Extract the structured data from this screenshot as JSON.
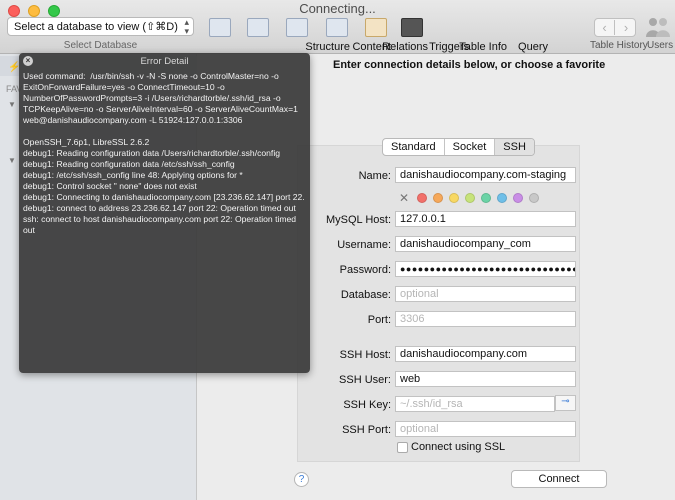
{
  "window": {
    "title": "Connecting..."
  },
  "toolbar": {
    "db_select": {
      "value": "Select a database to view (⇧⌘D)",
      "caption": "Select Database"
    },
    "items": [
      {
        "label": "Structure",
        "icon": "structure-icon"
      },
      {
        "label": "Content",
        "icon": "content-icon"
      },
      {
        "label": "Relations",
        "icon": "relations-icon"
      },
      {
        "label": "Triggers",
        "icon": "triggers-icon"
      },
      {
        "label": "Table Info",
        "icon": "table-info-icon"
      },
      {
        "label": "Query",
        "icon": "query-icon"
      }
    ],
    "table_history": "Table History",
    "users": "Users"
  },
  "sidebar": {
    "section": "FAV"
  },
  "main": {
    "heading": "Enter connection details below, or choose a favorite",
    "tabs": [
      {
        "label": "Standard"
      },
      {
        "label": "Socket"
      },
      {
        "label": "SSH"
      }
    ],
    "colors": [
      "#f2706a",
      "#f6a85a",
      "#f8d863",
      "#c7e37a",
      "#6bd3a6",
      "#6fbfe8",
      "#c98ee6",
      "#c8c8c8"
    ],
    "fields": {
      "name": {
        "label": "Name:",
        "value": "danishaudiocompany.com-staging"
      },
      "mysql_host": {
        "label": "MySQL Host:",
        "value": "127.0.0.1"
      },
      "username": {
        "label": "Username:",
        "value": "danishaudiocompany_com"
      },
      "password": {
        "label": "Password:",
        "value": "●●●●●●●●●●●●●●●●●●●●●●●●●●●●●●●●●●●"
      },
      "database": {
        "label": "Database:",
        "placeholder": "optional"
      },
      "port": {
        "label": "Port:",
        "placeholder": "3306"
      },
      "ssh_host": {
        "label": "SSH Host:",
        "value": "danishaudiocompany.com"
      },
      "ssh_user": {
        "label": "SSH User:",
        "value": "web"
      },
      "ssh_key": {
        "label": "SSH Key:",
        "placeholder": "~/.ssh/id_rsa"
      },
      "ssh_port": {
        "label": "SSH Port:",
        "placeholder": "optional"
      }
    },
    "ssl_label": "Connect using SSL",
    "help": "?",
    "connect": "Connect"
  },
  "error_detail": {
    "title": "Error Detail",
    "close": "×",
    "body": "Used command:  /usr/bin/ssh -v -N -S none -o ControlMaster=no -o ExitOnForwardFailure=yes -o ConnectTimeout=10 -o NumberOfPasswordPrompts=3 -i /Users/richardtorble/.ssh/id_rsa -o TCPKeepAlive=no -o ServerAliveInterval=60 -o ServerAliveCountMax=1 web@danishaudiocompany.com -L 51924:127.0.0.1:3306\n\nOpenSSH_7.6p1, LibreSSL 2.6.2\ndebug1: Reading configuration data /Users/richardtorble/.ssh/config\ndebug1: Reading configuration data /etc/ssh/ssh_config\ndebug1: /etc/ssh/ssh_config line 48: Applying options for *\ndebug1: Control socket \" none\" does not exist\ndebug1: Connecting to danishaudiocompany.com [23.236.62.147] port 22.\ndebug1: connect to address 23.236.62.147 port 22: Operation timed out\nssh: connect to host danishaudiocompany.com port 22: Operation timed out"
  }
}
